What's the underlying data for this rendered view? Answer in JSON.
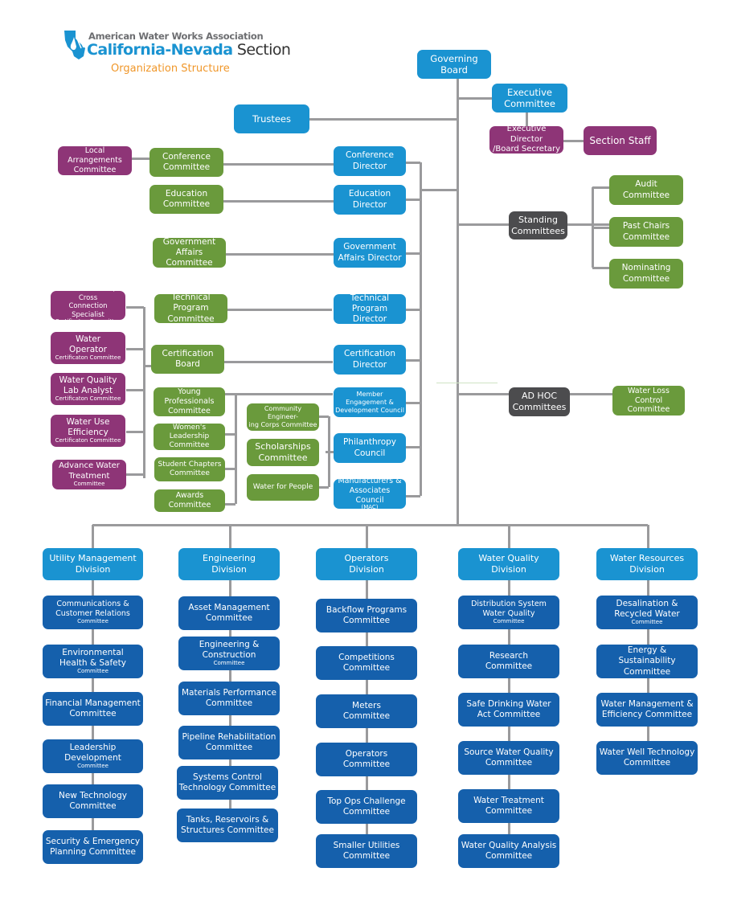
{
  "header": {
    "org_line": "American Water Works Association",
    "section_bold": "California-Nevada",
    "section_rest": " Section",
    "subtitle": "Organization Structure",
    "logo_icon": "california-nevada-map-icon"
  },
  "colors": {
    "light_blue": "#1a93d1",
    "dark_blue": "#1560ac",
    "green": "#6a9a3c",
    "purple": "#8e3577",
    "dark_gray": "#4c4c4e",
    "connector": "#9a9a9c",
    "subtitle_orange": "#f0972a"
  },
  "top": {
    "governing_board": [
      "Governing",
      "Board"
    ],
    "executive_committee": [
      "Executive",
      "Committee"
    ],
    "trustees": "Trustees",
    "executive_director": [
      "Executive Director",
      "/Board Secretary"
    ],
    "section_staff": "Section Staff"
  },
  "directors": [
    [
      "Conference",
      "Director"
    ],
    [
      "Education",
      "Director"
    ],
    [
      "Government",
      "Affairs Director"
    ],
    [
      "Technical Program",
      "Director"
    ],
    [
      "Certification",
      "Director"
    ],
    [
      "Member",
      "Engagement &",
      "Development Council"
    ],
    [
      "Philanthropy",
      "Council"
    ],
    [
      "Manufacturers &",
      "Associates Council",
      "(MAC)"
    ]
  ],
  "committees_green": {
    "conference": [
      "Conference",
      "Committee"
    ],
    "education": [
      "Education",
      "Committee"
    ],
    "government": [
      "Government",
      "Affairs Committee"
    ],
    "technical": [
      "Technical Program",
      "Committee"
    ],
    "certification_board": [
      "Certification",
      "Board"
    ],
    "young_professionals": [
      "Young Professionals",
      "Committee"
    ],
    "womens_leadership": [
      "Women's Leadership",
      "Committee"
    ],
    "student_chapters": [
      "Student Chapters",
      "Committee"
    ],
    "awards": [
      "Awards",
      "Committee"
    ],
    "community_engineering": [
      "Community Engineer-",
      "ing Corps Committee"
    ],
    "scholarships": [
      "Scholarships",
      "Committee"
    ],
    "water_for_people": "Water for People"
  },
  "committees_purple": {
    "local_arrangements": [
      "Local Arrangements",
      "Committee"
    ],
    "backflow_tester": [
      "Backflow Tester/ Cross",
      "Connection Specialist",
      "Certificaton Committee"
    ],
    "water_operator": [
      "Water",
      "Operator",
      "Certificaton Committee"
    ],
    "water_quality_lab": [
      "Water Quality",
      "Lab Analyst",
      "Certificaton Committee"
    ],
    "water_use_efficiency": [
      "Water Use",
      "Efficiency",
      "Certificaton Committee"
    ],
    "advance_water_treatment": [
      "Advance Water",
      "Treatment",
      "Committee"
    ]
  },
  "standing": {
    "label": [
      "Standing",
      "Committees"
    ],
    "items": [
      [
        "Audit",
        "Committee"
      ],
      [
        "Past Chairs",
        "Committee"
      ],
      [
        "Nominating",
        "Committee"
      ]
    ]
  },
  "adhoc": {
    "label": [
      "AD HOC",
      "Committees"
    ],
    "items": [
      [
        "Water Loss Control",
        "Committee"
      ]
    ]
  },
  "divisions": [
    {
      "name": [
        "Utility Management",
        "Division"
      ],
      "committees": [
        [
          "Communications &",
          "Customer Relations",
          "Committee"
        ],
        [
          "Environmental",
          "Health & Safety",
          "Committee"
        ],
        [
          "Financial Management",
          "Committee"
        ],
        [
          "Leadership",
          "Development",
          "Committee"
        ],
        [
          "New Technology",
          "Committee"
        ],
        [
          "Security & Emergency",
          "Planning Committee"
        ]
      ]
    },
    {
      "name": [
        "Engineering",
        "Division"
      ],
      "committees": [
        [
          "Asset Management",
          "Committee"
        ],
        [
          "Engineering &",
          "Construction",
          "Committee"
        ],
        [
          "Materials Performance",
          "Committee"
        ],
        [
          "Pipeline Rehabilitation",
          "Committee"
        ],
        [
          "Systems Control",
          "Technology Committee"
        ],
        [
          "Tanks, Reservoirs &",
          "Structures Committee"
        ]
      ]
    },
    {
      "name": [
        "Operators",
        "Division"
      ],
      "committees": [
        [
          "Backflow Programs",
          "Committee"
        ],
        [
          "Competitions",
          "Committee"
        ],
        [
          "Meters",
          "Committee"
        ],
        [
          "Operators",
          "Committee"
        ],
        [
          "Top Ops Challenge",
          "Committee"
        ],
        [
          "Smaller Utilities",
          "Committee"
        ]
      ]
    },
    {
      "name": [
        "Water Quality",
        "Division"
      ],
      "committees": [
        [
          "Distribution System",
          "Water Quality",
          "Committee"
        ],
        [
          "Research",
          "Committee"
        ],
        [
          "Safe Drinking Water",
          "Act Committee"
        ],
        [
          "Source Water Quality",
          "Committee"
        ],
        [
          "Water Treatment",
          "Committee"
        ],
        [
          "Water Quality Analysis",
          "Committee"
        ]
      ]
    },
    {
      "name": [
        "Water Resources",
        "Division"
      ],
      "committees": [
        [
          "Desalination &",
          "Recycled Water",
          "Committee"
        ],
        [
          "Energy & Sustainability",
          "Committee"
        ],
        [
          "Water Management &",
          "Efficiency Committee"
        ],
        [
          "Water Well Technology",
          "Committee"
        ]
      ]
    }
  ]
}
